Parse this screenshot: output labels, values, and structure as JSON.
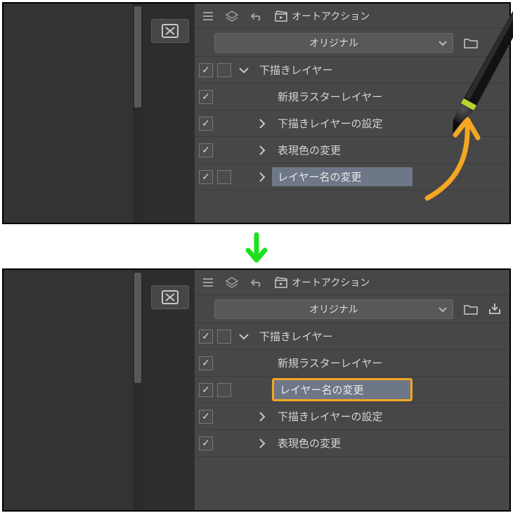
{
  "toolbar": {
    "tab_label": "オートアクション"
  },
  "dropdown": {
    "label": "オリジナル"
  },
  "top_rows": [
    {
      "chk": true,
      "swatch": true,
      "exp": "down",
      "indent": 0,
      "label": "下描きレイヤー",
      "sel": false
    },
    {
      "chk": true,
      "swatch": false,
      "exp": "none",
      "indent": 1,
      "label": "新規ラスターレイヤー",
      "sel": false
    },
    {
      "chk": true,
      "swatch": false,
      "exp": "right",
      "indent": 1,
      "label": "下描きレイヤーの設定",
      "sel": false
    },
    {
      "chk": true,
      "swatch": false,
      "exp": "right",
      "indent": 1,
      "label": "表現色の変更",
      "sel": false
    },
    {
      "chk": true,
      "swatch": true,
      "exp": "right",
      "indent": 1,
      "label": "レイヤー名の変更",
      "sel": true
    }
  ],
  "bot_rows": [
    {
      "chk": true,
      "swatch": true,
      "exp": "down",
      "indent": 0,
      "label": "下描きレイヤー",
      "sel": false,
      "hl": false
    },
    {
      "chk": true,
      "swatch": false,
      "exp": "none",
      "indent": 1,
      "label": "新規ラスターレイヤー",
      "sel": false,
      "hl": false
    },
    {
      "chk": true,
      "swatch": true,
      "exp": "none",
      "indent": 1,
      "label": "レイヤー名の変更",
      "sel": true,
      "hl": true
    },
    {
      "chk": true,
      "swatch": false,
      "exp": "right",
      "indent": 1,
      "label": "下描きレイヤーの設定",
      "sel": false,
      "hl": false
    },
    {
      "chk": true,
      "swatch": false,
      "exp": "right",
      "indent": 1,
      "label": "表現色の変更",
      "sel": false,
      "hl": false
    }
  ],
  "colors": {
    "accent_arrow": "#f5a623",
    "down_arrow": "#1de01d"
  }
}
